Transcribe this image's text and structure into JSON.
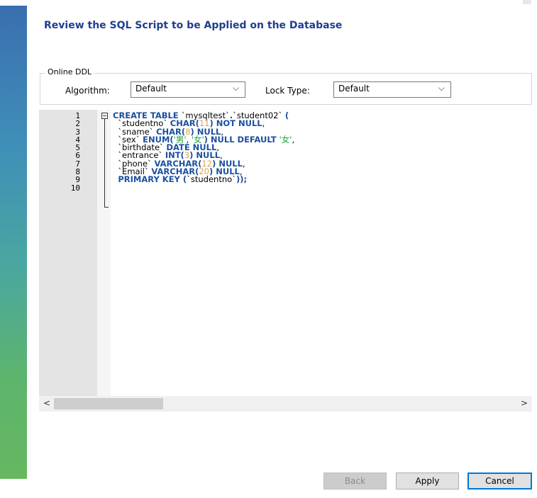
{
  "title": "Review the SQL Script to be Applied on the Database",
  "online_ddl": {
    "legend": "Online DDL",
    "algorithm_label": "Algorithm:",
    "algorithm_value": "Default",
    "lock_type_label": "Lock Type:",
    "lock_type_value": "Default"
  },
  "editor": {
    "line_numbers": [
      "1",
      "2",
      "3",
      "4",
      "5",
      "6",
      "7",
      "8",
      "9",
      "10"
    ],
    "lines": [
      [
        [
          "kw",
          "CREATE TABLE "
        ],
        [
          "id",
          "`mysqltest`"
        ],
        [
          "kw",
          "."
        ],
        [
          "id",
          "`student02`"
        ],
        [
          "id",
          " "
        ],
        [
          "kw",
          "("
        ]
      ],
      [
        [
          "id",
          "  `studentno` "
        ],
        [
          "kw",
          "CHAR("
        ],
        [
          "num",
          "11"
        ],
        [
          "kw",
          ") NOT NULL"
        ],
        [
          "id",
          ","
        ]
      ],
      [
        [
          "id",
          "  `sname` "
        ],
        [
          "kw",
          "CHAR("
        ],
        [
          "num",
          "8"
        ],
        [
          "kw",
          ") NULL"
        ],
        [
          "id",
          ","
        ]
      ],
      [
        [
          "id",
          "  `sex` "
        ],
        [
          "kw",
          "ENUM("
        ],
        [
          "str",
          "'男'"
        ],
        [
          "id",
          ", "
        ],
        [
          "str",
          "'女'"
        ],
        [
          "kw",
          ") NULL DEFAULT "
        ],
        [
          "str",
          "'女'"
        ],
        [
          "id",
          ","
        ]
      ],
      [
        [
          "id",
          "  `birthdate` "
        ],
        [
          "kw",
          "DATE NULL"
        ],
        [
          "id",
          ","
        ]
      ],
      [
        [
          "id",
          "  `entrance` "
        ],
        [
          "kw",
          "INT("
        ],
        [
          "num",
          "3"
        ],
        [
          "kw",
          ") NULL"
        ],
        [
          "id",
          ","
        ]
      ],
      [
        [
          "id",
          "  `phone` "
        ],
        [
          "kw",
          "VARCHAR("
        ],
        [
          "num",
          "12"
        ],
        [
          "kw",
          ") NULL"
        ],
        [
          "id",
          ","
        ]
      ],
      [
        [
          "id",
          "  `Email` "
        ],
        [
          "kw",
          "VARCHAR("
        ],
        [
          "num",
          "20"
        ],
        [
          "kw",
          ") NULL"
        ],
        [
          "id",
          ","
        ]
      ],
      [
        [
          "id",
          "  "
        ],
        [
          "kw",
          "PRIMARY KEY ("
        ],
        [
          "id",
          "`studentno`"
        ],
        [
          "kw",
          "));"
        ]
      ],
      []
    ]
  },
  "scrollbar": {
    "left_arrow": "<",
    "right_arrow": ">"
  },
  "buttons": {
    "back": "Back",
    "apply": "Apply",
    "cancel": "Cancel"
  },
  "icons": {
    "chevron": "chevron-down-icon",
    "fold": "collapse-icon"
  },
  "colors": {
    "title": "#1f3f8f",
    "keyword": "#1a4f9f",
    "number": "#e0a24f",
    "string": "#1e9e3b",
    "focus_border": "#0078d7"
  }
}
